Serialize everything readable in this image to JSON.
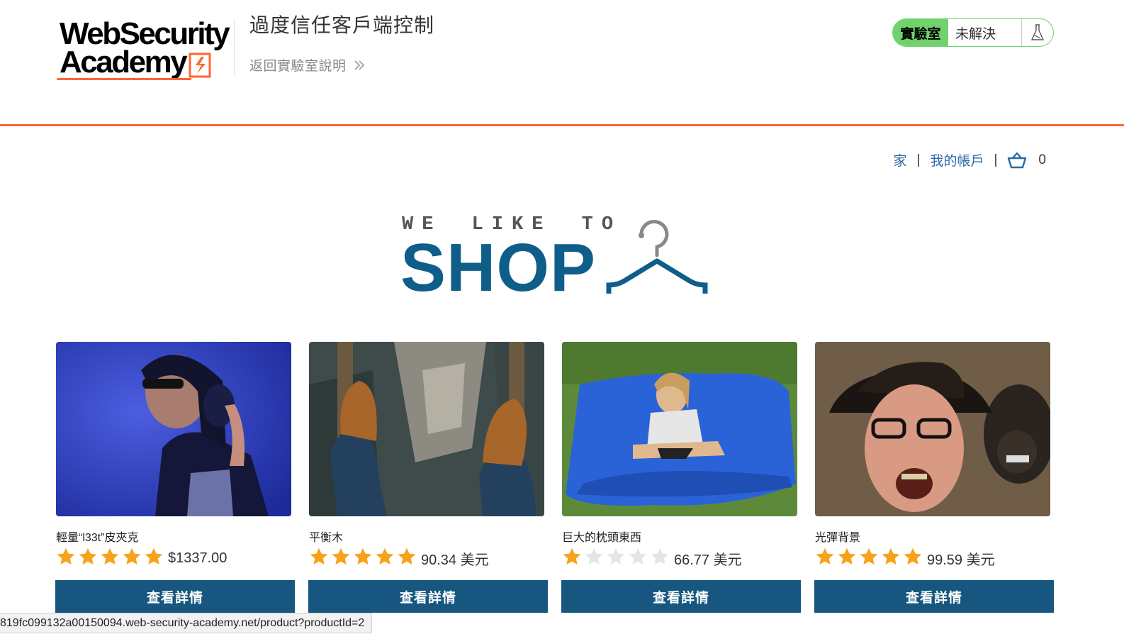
{
  "academy": {
    "logo_line1": "WebSecurity",
    "logo_line2": "Academy",
    "lab_title": "過度信任客戶端控制",
    "back_link": "返回實驗室說明",
    "status_label": "實驗室",
    "status_value": "未解決",
    "status_icon": "flask-icon",
    "accent_color": "#ff6633",
    "status_color": "#70d16d"
  },
  "nav": {
    "home": "家",
    "separator": "|",
    "account": "我的帳戶",
    "cart_count": "0",
    "cart_icon": "basket-icon"
  },
  "banner": {
    "small_text": "WE LIKE TO",
    "big_text": "SHOP",
    "icon": "hanger-icon",
    "color": "#0f5e8a"
  },
  "products": [
    {
      "name": "輕量“l33t”皮夾克",
      "rating": 5,
      "price": "$1337.00",
      "button": "查看詳情",
      "image": "person-with-headphones"
    },
    {
      "name": "平衡木",
      "rating": 5,
      "price": "90.34 美元",
      "button": "查看詳情",
      "image": "feet-above-city"
    },
    {
      "name": "巨大的枕頭東西",
      "rating": 1,
      "price": "66.77 美元",
      "button": "查看詳情",
      "image": "girl-on-blue-beanbag"
    },
    {
      "name": "光彈背景",
      "rating": 5,
      "price": "99.59 美元",
      "button": "查看詳情",
      "image": "man-and-monkey"
    }
  ],
  "button_color": "#16567f",
  "status_bar_url": "819fc099132a00150094.web-security-academy.net/product?productId=2"
}
